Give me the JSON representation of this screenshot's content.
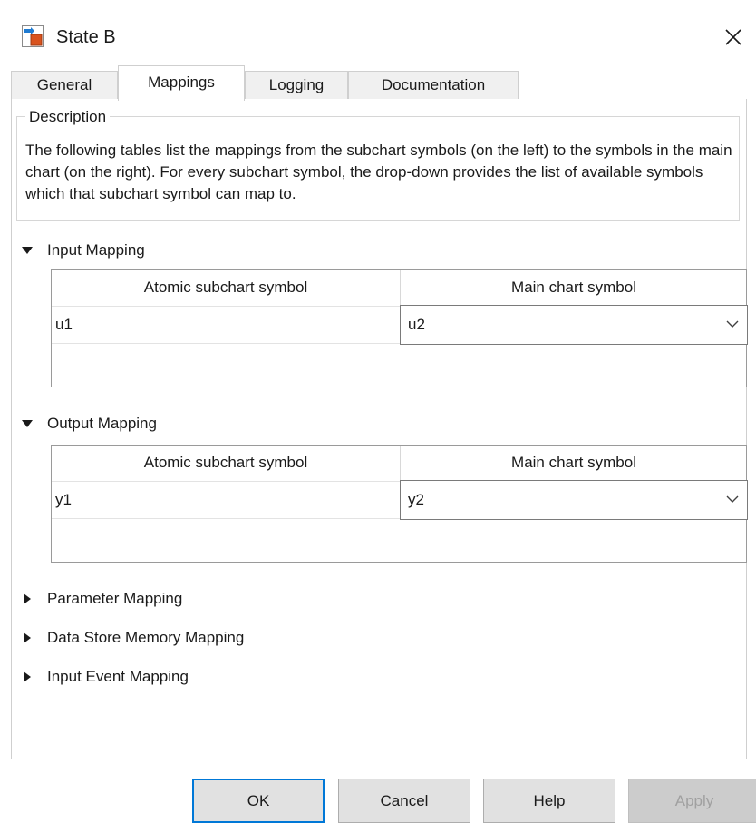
{
  "window": {
    "title": "State B",
    "icon": "stateflow-state-icon",
    "close_icon": "close-icon"
  },
  "tabs": [
    {
      "label": "General",
      "active": false
    },
    {
      "label": "Mappings",
      "active": true
    },
    {
      "label": "Logging",
      "active": false
    },
    {
      "label": "Documentation",
      "active": false
    }
  ],
  "description": {
    "legend": "Description",
    "text": "The following tables list the mappings from the subchart symbols (on the left) to the symbols in the main chart (on the right). For every subchart symbol, the drop-down provides the list of available symbols which that subchart symbol can map to."
  },
  "input_mapping": {
    "label": "Input Mapping",
    "expanded": true,
    "col_subchart": "Atomic subchart symbol",
    "col_main": "Main chart symbol",
    "rows": [
      {
        "subchart_symbol": "u1",
        "main_symbol": "u2"
      }
    ]
  },
  "output_mapping": {
    "label": "Output Mapping",
    "expanded": true,
    "col_subchart": "Atomic subchart symbol",
    "col_main": "Main chart symbol",
    "rows": [
      {
        "subchart_symbol": "y1",
        "main_symbol": "y2"
      }
    ]
  },
  "collapsed_sections": [
    {
      "label": "Parameter Mapping",
      "expanded": false
    },
    {
      "label": "Data Store Memory Mapping",
      "expanded": false
    },
    {
      "label": "Input Event Mapping",
      "expanded": false
    }
  ],
  "buttons": {
    "ok": "OK",
    "cancel": "Cancel",
    "help": "Help",
    "apply": "Apply",
    "apply_enabled": false
  },
  "colors": {
    "accent": "#0078d7",
    "disabled_text": "#a0a0a0"
  }
}
